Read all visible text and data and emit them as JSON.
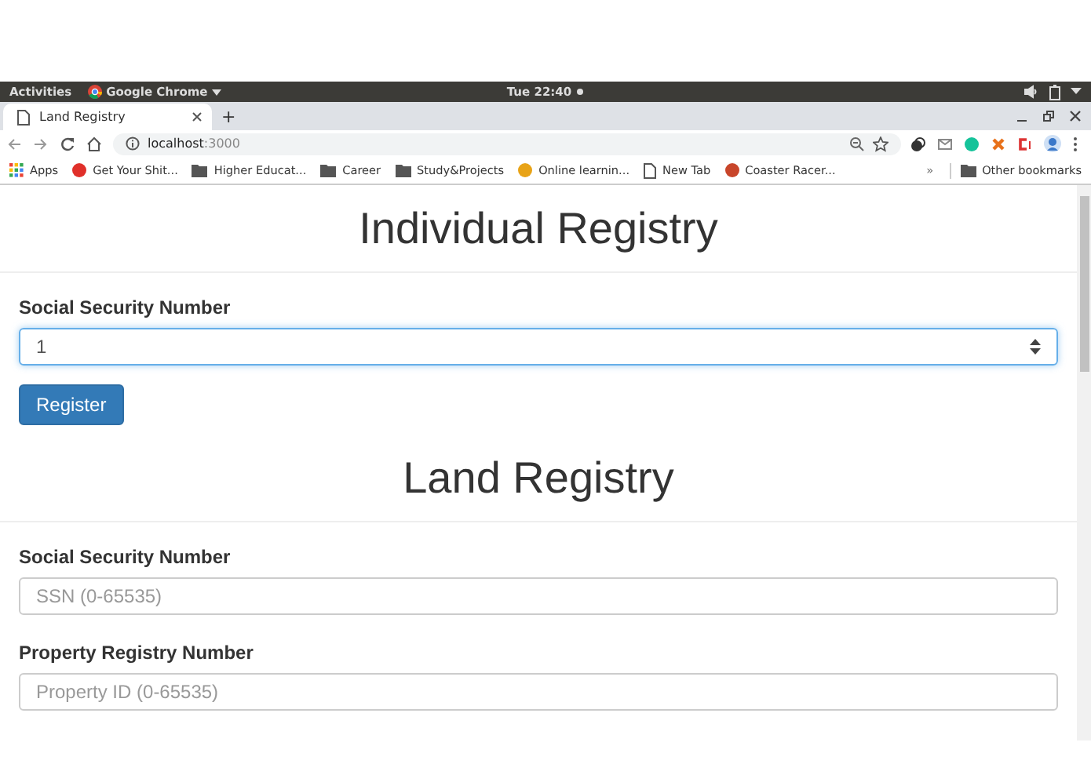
{
  "system_bar": {
    "activities": "Activities",
    "app": "Google Chrome",
    "clock": "Tue 22:40"
  },
  "browser": {
    "tabs": [
      {
        "title": "Land Registry",
        "selected": true
      }
    ],
    "new_tab": "+",
    "address": {
      "host": "localhost",
      "port": ":3000"
    },
    "bookmarks": [
      {
        "kind": "apps",
        "label": "Apps"
      },
      {
        "kind": "site",
        "label": "Get Your Shit...",
        "color": "#e0302a"
      },
      {
        "kind": "folder",
        "label": "Higher Educat..."
      },
      {
        "kind": "folder",
        "label": "Career"
      },
      {
        "kind": "folder",
        "label": "Study&Projects"
      },
      {
        "kind": "site",
        "label": "Online learnin...",
        "color": "#e8a317"
      },
      {
        "kind": "page",
        "label": "New Tab"
      },
      {
        "kind": "site",
        "label": "Coaster Racer...",
        "color": "#c8452a"
      }
    ],
    "more": "»",
    "other_bookmarks": "Other bookmarks"
  },
  "page": {
    "sections": [
      {
        "title": "Individual Registry",
        "fields": [
          {
            "label": "Social Security Number",
            "value": "1",
            "focused": true
          }
        ],
        "button": "Register"
      },
      {
        "title": "Land Registry",
        "fields": [
          {
            "label": "Social Security Number",
            "placeholder": "SSN (0-65535)",
            "focused": false
          },
          {
            "label": "Property Registry Number",
            "placeholder": "Property ID (0-65535)",
            "focused": false
          }
        ]
      }
    ]
  }
}
